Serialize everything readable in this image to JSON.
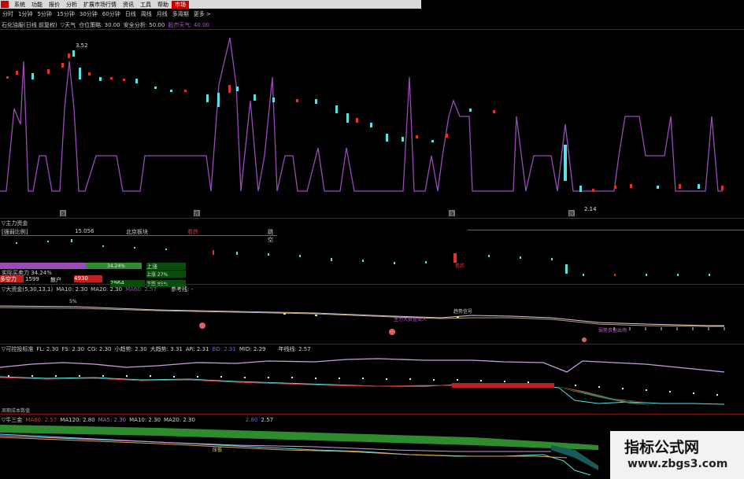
{
  "menu": [
    "系统",
    "功能",
    "报价",
    "分析",
    "扩展市场行情",
    "资讯",
    "工具",
    "帮助",
    "市场"
  ],
  "periods": [
    "分时",
    "1分钟",
    "5分钟",
    "15分钟",
    "30分钟",
    "60分钟",
    "日线",
    "周线",
    "月线",
    "多周期",
    "更多 >"
  ],
  "panel1": {
    "title": "石化油服(日线 前复权)",
    "ind": "▽天气",
    "f1": "仓位策略: 30.00",
    "f2": "安全分析: 50.00",
    "f3": "股市天气: 40.00",
    "high_label": "3.52",
    "low_label": "2.14",
    "markers": [
      "涨",
      "跌",
      "涨",
      "跌"
    ]
  },
  "panel2": {
    "title": "▽主力资金",
    "ratio_label": "[强弱比例]",
    "ratio_value": "15.056",
    "sector": "北京板块",
    "tag_red": "看跌",
    "tag_right": "跳空",
    "info": {
      "r1a": "实际买卖力 34.24%",
      "r1b": "34.24%",
      "r1c": "上涨",
      "r2a": "多空力",
      "r2b": "1599",
      "r2c": "散户",
      "r2d": "4930",
      "r2e": "上涨 27%",
      "r3a": "2964",
      "r3b": "下跌 85%"
    },
    "arrow_label": "看跌"
  },
  "panel3": {
    "title": "▽大资金(5,30,13,1)",
    "ma10": "MA10: 2.30",
    "ma20": "MA20: 2.30",
    "ma60": "MA60: 2.57",
    "ref": "参考线: -",
    "pct": "5%",
    "label_a": "主力大资金流入",
    "label_b": "趋势信号",
    "label_c": "弱势资金出场"
  },
  "panel4": {
    "title": "▽可控投标准",
    "fl": "FL: 2.30",
    "fs": "FS: 2.30",
    "cg": "CG: 2.30",
    "trend": "小趋势: 2.30",
    "big": "大趋势: 3.31",
    "ar": "AR: 2.31",
    "bd": "BD: 2.31",
    "mid": "MID: 2.29",
    "nian": "年线线: 2.57"
  },
  "panel5": {
    "label": "周期成本数值",
    "title": "▽牛三金",
    "ma60": "MA60: 2.57",
    "ma120": "MA120: 2.80",
    "ma5": "MA5: 2.30",
    "ma10": "MA10: 2.30",
    "ma20": "MA20: 2.30",
    "v1": "2.80",
    "v2": "2.57",
    "mark": "压低"
  },
  "brand": {
    "name": "指标公式网",
    "url": "www.zbgs3.com"
  },
  "colors": {
    "purple": "#9b4bb8",
    "cyan": "#5fe0e0",
    "red": "#e03030",
    "green": "#2e8b2e",
    "grid": "#7a1010"
  }
}
